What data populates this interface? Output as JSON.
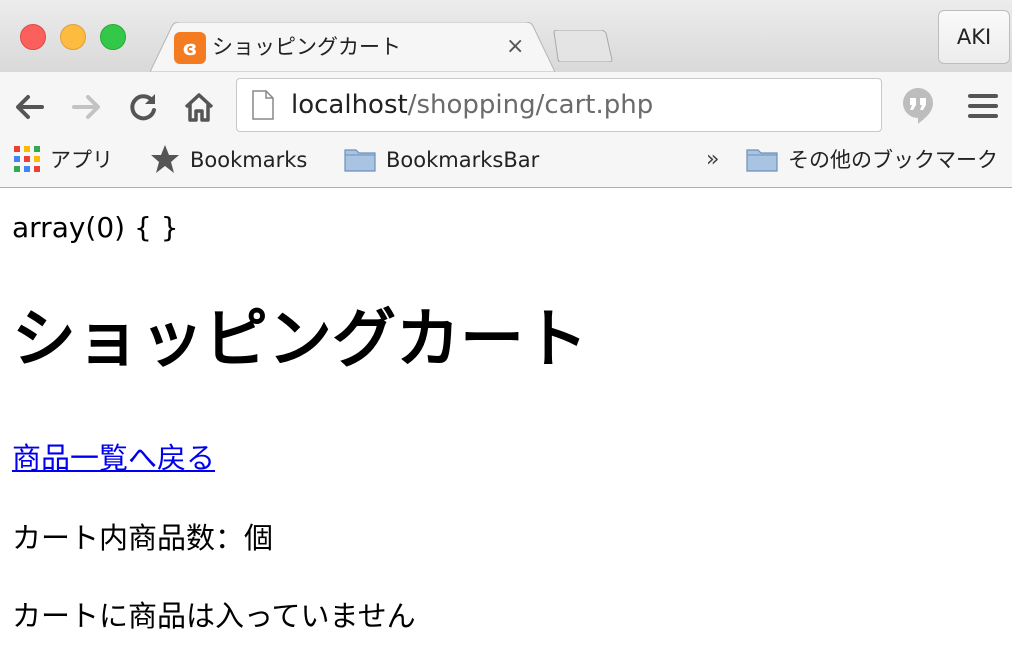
{
  "browser": {
    "tab": {
      "title": "ショッピングカート",
      "favicon": "xampp-icon",
      "close": "×"
    },
    "profile": "AKI",
    "url": {
      "host": "localhost",
      "path": "/shopping/cart.php"
    },
    "bookmarks": {
      "apps": "アプリ",
      "bookmarks": "Bookmarks",
      "bar": "BookmarksBar",
      "chevron": "»",
      "other": "その他のブックマーク"
    }
  },
  "page": {
    "var_dump": "array(0) { }",
    "heading": "ショッピングカート",
    "back_link": "商品一覧へ戻る",
    "item_count": "カート内商品数：個",
    "empty_message": "カートに商品は入っていません"
  },
  "colors": {
    "link": "#0000ee",
    "favicon": "#f47b20"
  }
}
